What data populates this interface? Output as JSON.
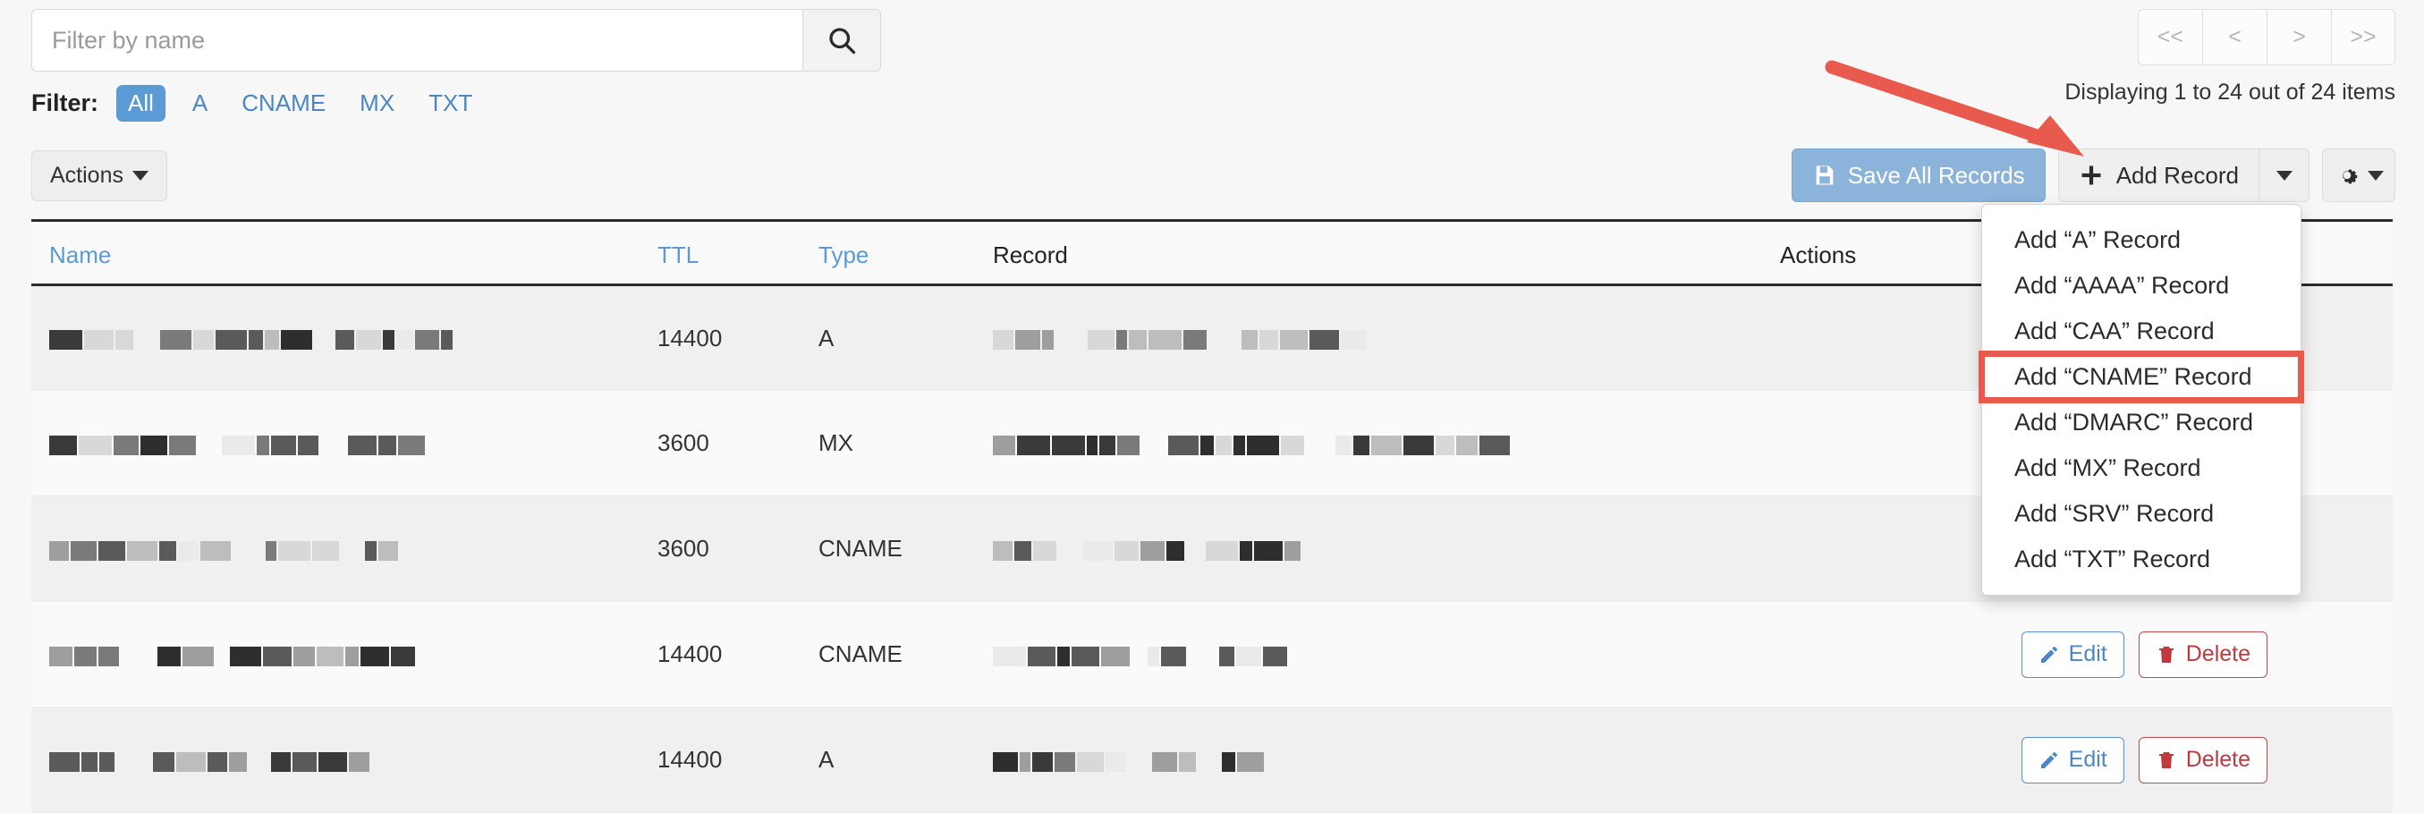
{
  "search": {
    "placeholder": "Filter by name",
    "value": "",
    "icon": "search-icon"
  },
  "filter": {
    "label": "Filter:",
    "options": [
      "All",
      "A",
      "CNAME",
      "MX",
      "TXT"
    ],
    "active": "All",
    "active_bg": "#5b9bd5"
  },
  "pagination": {
    "buttons": [
      "<<",
      "<",
      ">",
      ">>"
    ],
    "status": "Displaying 1 to 24 out of 24 items"
  },
  "toolbar": {
    "actions_label": "Actions",
    "save_all_label": "Save All Records",
    "save_icon": "floppy-disk-icon",
    "add_record_label": "Add Record",
    "add_record_icon": "plus-icon",
    "add_record_caret_icon": "chevron-down-icon",
    "settings_icon": "gear-icon",
    "save_all_color": "#8cb4da"
  },
  "table": {
    "columns": [
      {
        "label": "Name",
        "sortable": true
      },
      {
        "label": "TTL",
        "sortable": true
      },
      {
        "label": "Type",
        "sortable": true
      },
      {
        "label": "Record",
        "sortable": false
      },
      {
        "label": "Actions",
        "sortable": false
      }
    ],
    "edit_label": "Edit",
    "edit_icon": "pencil-icon",
    "delete_label": "Delete",
    "delete_icon": "trash-icon",
    "rows": [
      {
        "name": "",
        "ttl": "14400",
        "type": "A",
        "record": "",
        "redacted": true
      },
      {
        "name": "",
        "ttl": "3600",
        "type": "MX",
        "record": "",
        "redacted": true
      },
      {
        "name": "",
        "ttl": "3600",
        "type": "CNAME",
        "record": "",
        "redacted": true
      },
      {
        "name": "",
        "ttl": "14400",
        "type": "CNAME",
        "record": "",
        "redacted": true
      },
      {
        "name": "",
        "ttl": "14400",
        "type": "A",
        "record": "",
        "redacted": true
      }
    ]
  },
  "add_record_menu": {
    "items": [
      "Add “A” Record",
      "Add “AAAA” Record",
      "Add “CAA” Record",
      "Add “CNAME” Record",
      "Add “DMARC” Record",
      "Add “MX” Record",
      "Add “SRV” Record",
      "Add “TXT” Record"
    ],
    "highlighted": "Add “CNAME” Record",
    "highlight_color": "#e8594e"
  },
  "annotation": {
    "arrow_color": "#e8594e",
    "points_to": "Add “CNAME” Record"
  }
}
